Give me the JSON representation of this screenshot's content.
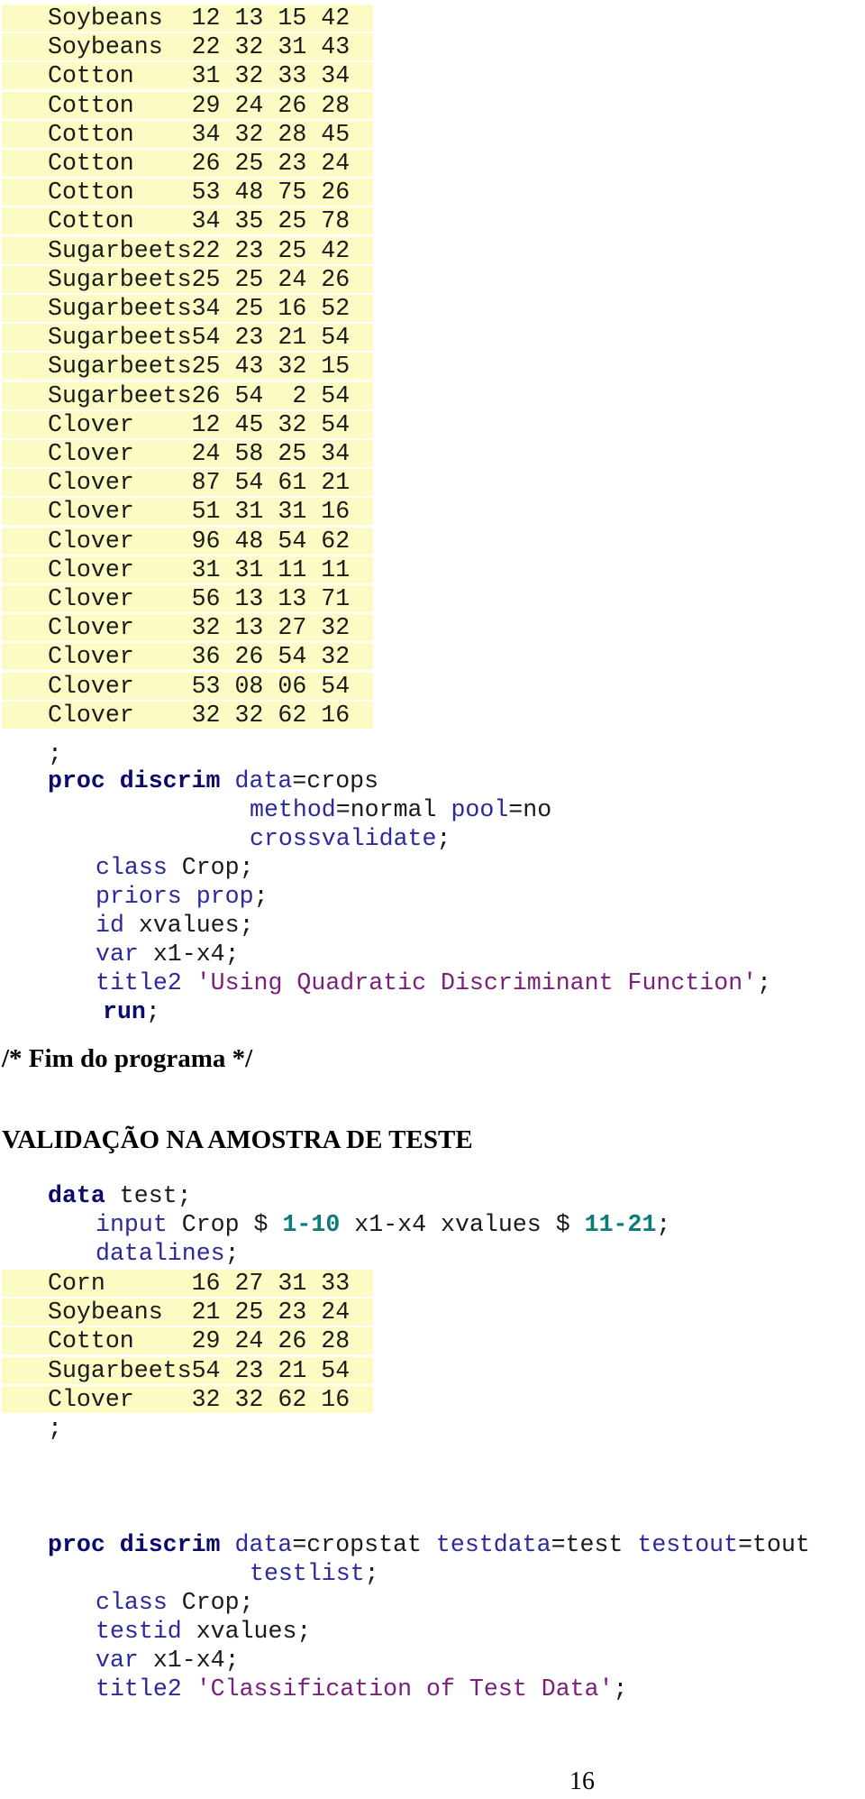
{
  "training_data_rows": [
    {
      "crop": "Soybeans",
      "x": [
        "12",
        "13",
        "15",
        "42"
      ]
    },
    {
      "crop": "Soybeans",
      "x": [
        "22",
        "32",
        "31",
        "43"
      ]
    },
    {
      "crop": "Cotton",
      "x": [
        "31",
        "32",
        "33",
        "34"
      ]
    },
    {
      "crop": "Cotton",
      "x": [
        "29",
        "24",
        "26",
        "28"
      ]
    },
    {
      "crop": "Cotton",
      "x": [
        "34",
        "32",
        "28",
        "45"
      ]
    },
    {
      "crop": "Cotton",
      "x": [
        "26",
        "25",
        "23",
        "24"
      ]
    },
    {
      "crop": "Cotton",
      "x": [
        "53",
        "48",
        "75",
        "26"
      ]
    },
    {
      "crop": "Cotton",
      "x": [
        "34",
        "35",
        "25",
        "78"
      ]
    },
    {
      "crop": "Sugarbeets",
      "x": [
        "22",
        "23",
        "25",
        "42"
      ]
    },
    {
      "crop": "Sugarbeets",
      "x": [
        "25",
        "25",
        "24",
        "26"
      ]
    },
    {
      "crop": "Sugarbeets",
      "x": [
        "34",
        "25",
        "16",
        "52"
      ]
    },
    {
      "crop": "Sugarbeets",
      "x": [
        "54",
        "23",
        "21",
        "54"
      ]
    },
    {
      "crop": "Sugarbeets",
      "x": [
        "25",
        "43",
        "32",
        "15"
      ]
    },
    {
      "crop": "Sugarbeets",
      "x": [
        "26",
        "54",
        " 2",
        "54"
      ]
    },
    {
      "crop": "Clover",
      "x": [
        "12",
        "45",
        "32",
        "54"
      ]
    },
    {
      "crop": "Clover",
      "x": [
        "24",
        "58",
        "25",
        "34"
      ]
    },
    {
      "crop": "Clover",
      "x": [
        "87",
        "54",
        "61",
        "21"
      ]
    },
    {
      "crop": "Clover",
      "x": [
        "51",
        "31",
        "31",
        "16"
      ]
    },
    {
      "crop": "Clover",
      "x": [
        "96",
        "48",
        "54",
        "62"
      ]
    },
    {
      "crop": "Clover",
      "x": [
        "31",
        "31",
        "11",
        "11"
      ]
    },
    {
      "crop": "Clover",
      "x": [
        "56",
        "13",
        "13",
        "71"
      ]
    },
    {
      "crop": "Clover",
      "x": [
        "32",
        "13",
        "27",
        "32"
      ]
    },
    {
      "crop": "Clover",
      "x": [
        "36",
        "26",
        "54",
        "32"
      ]
    },
    {
      "crop": "Clover",
      "x": [
        "53",
        "08",
        "06",
        "54"
      ]
    },
    {
      "crop": "Clover",
      "x": [
        "32",
        "32",
        "62",
        "16"
      ]
    }
  ],
  "block1": {
    "terminator": ";",
    "proc_kw": "proc discrim",
    "opt_data": "data",
    "val_data": "=crops",
    "opt_method": "method",
    "val_method": "=normal ",
    "opt_pool": "pool",
    "val_pool": "=no",
    "opt_cross": "crossvalidate",
    "semi": ";",
    "class_kw": "class",
    "class_val": " Crop;",
    "priors_kw": "priors prop",
    "priors_end": ";",
    "id_kw": "id",
    "id_val": " xvalues;",
    "var_kw": "var",
    "var_val": " x1-x4;",
    "title_kw": "title2 ",
    "title_str": "'Using Quadratic Discriminant Function'",
    "title_end": ";",
    "run_kw": "run",
    "run_end": ";"
  },
  "comment_heading": "/* Fim do programa */",
  "section_heading": "VALIDAÇÃO NA AMOSTRA DE TESTE",
  "block2": {
    "data_kw": "data",
    "data_val": " test;",
    "input_kw": "input",
    "input_a": " Crop $ ",
    "input_n1": "1-10",
    "input_b": " x1-x4 xvalues $ ",
    "input_n2": "11-21",
    "input_end": ";",
    "datalines_kw": "datalines",
    "datalines_end": ";",
    "terminator": ";"
  },
  "test_data_rows": [
    {
      "crop": "Corn",
      "x": [
        "16",
        "27",
        "31",
        "33"
      ]
    },
    {
      "crop": "Soybeans",
      "x": [
        "21",
        "25",
        "23",
        "24"
      ]
    },
    {
      "crop": "Cotton",
      "x": [
        "29",
        "24",
        "26",
        "28"
      ]
    },
    {
      "crop": "Sugarbeets",
      "x": [
        "54",
        "23",
        "21",
        "54"
      ]
    },
    {
      "crop": "Clover",
      "x": [
        "32",
        "32",
        "62",
        "16"
      ]
    }
  ],
  "block3": {
    "proc_kw": "proc discrim",
    "opt_data": "data",
    "val_data": "=cropstat ",
    "opt_testdata": "testdata",
    "val_testdata": "=test ",
    "opt_testout": "testout",
    "val_testout": "=tout",
    "opt_testlist": "testlist",
    "semi": ";",
    "class_kw": "class",
    "class_val": " Crop;",
    "testid_kw": "testid",
    "testid_val": " xvalues;",
    "var_kw": "var",
    "var_val": " x1-x4;",
    "title_kw": "title2 ",
    "title_str": "'Classification of Test Data'",
    "title_end": ";"
  },
  "page_number": "16",
  "colors": {
    "keyword": "#0b0b6e",
    "statement": "#2a2a9a",
    "string": "#7a1f7a",
    "numeric": "#0e7b7b",
    "datalines_bg": "#fdfbc4"
  }
}
